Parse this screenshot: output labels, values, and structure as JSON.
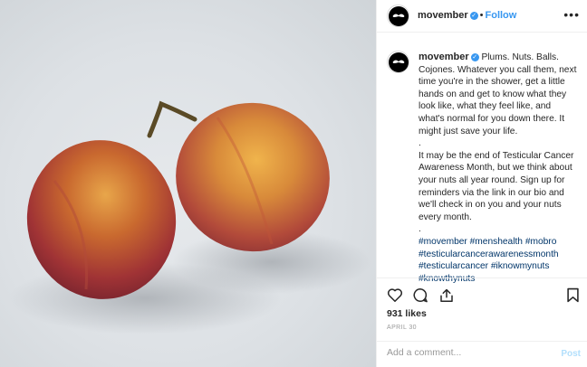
{
  "account": {
    "username": "movember",
    "verified_icon": "verified-badge-icon"
  },
  "header": {
    "follow_label": "Follow",
    "dot": "•",
    "more_icon": "more-options-icon",
    "more_glyph": "•••"
  },
  "caption": {
    "paragraph1": "Plums. Nuts. Balls. Cojones. Whatever you call them, next time you're in the shower, get a little hands on and get to know what they look like, what they feel like, and what's normal for you down there. It might just save your life.",
    "separator1": ".",
    "paragraph2": "It may be the end of Testicular Cancer Awareness Month, but we think about your nuts all year round. Sign up for reminders via the link in our bio and we'll check in on you and your nuts every month.",
    "separator2": ".",
    "hashtags": [
      "#movember",
      "#menshealth",
      "#mobro",
      "#testicularcancerawarenessmonth",
      "#testicularcancer",
      "#iknowmynuts",
      "#knowthynuts"
    ]
  },
  "actions": {
    "like_icon": "heart-icon",
    "comment_icon": "comment-icon",
    "share_icon": "share-icon",
    "save_icon": "bookmark-icon"
  },
  "likes_text": "931 likes",
  "date_text": "APRIL 30",
  "comment": {
    "placeholder": "Add a comment...",
    "post_label": "Post"
  },
  "colors": {
    "accent": "#3897f0",
    "hashtag": "#003569",
    "post_disabled": "#b2dffc"
  }
}
